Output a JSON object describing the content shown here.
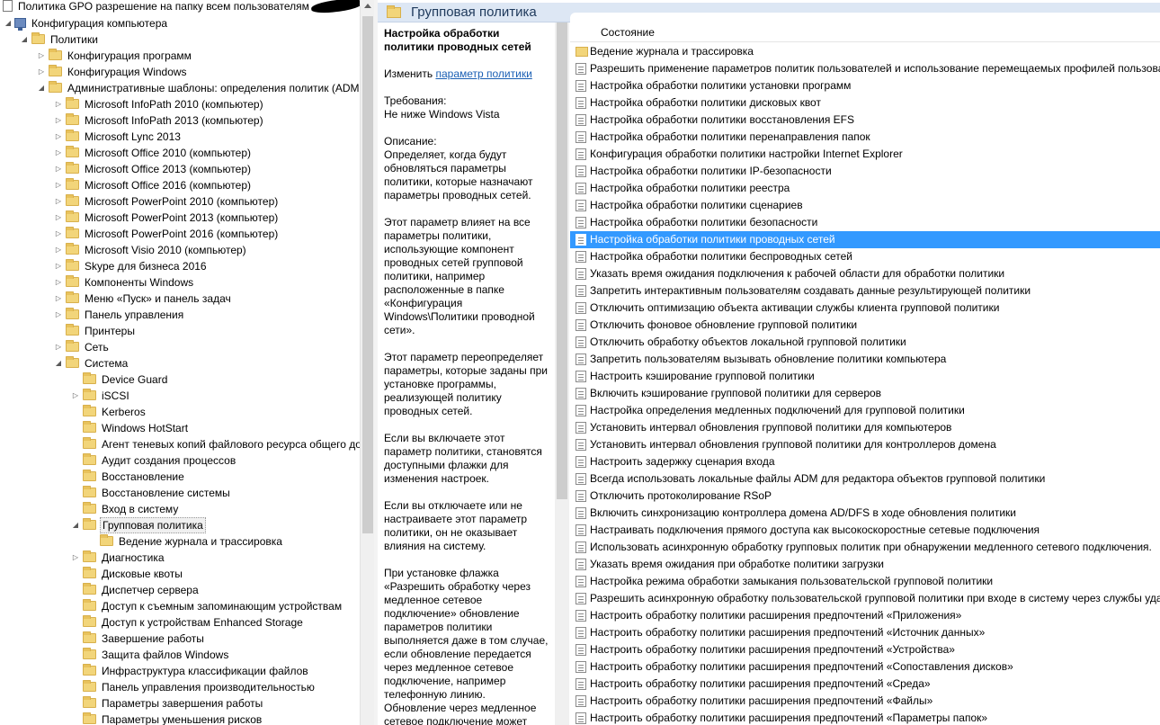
{
  "tree": {
    "root_title": "Политика GPO разрешение на папку всем пользователям",
    "items": [
      {
        "label": "Конфигурация компьютера",
        "level": 1,
        "expander": "open",
        "icon": "computer"
      },
      {
        "label": "Политики",
        "level": 2,
        "expander": "open",
        "icon": "folder"
      },
      {
        "label": "Конфигурация программ",
        "level": 3,
        "expander": "closed",
        "icon": "folder"
      },
      {
        "label": "Конфигурация Windows",
        "level": 3,
        "expander": "closed",
        "icon": "folder"
      },
      {
        "label": "Административные шаблоны: определения политик (ADMX",
        "level": 3,
        "expander": "open",
        "icon": "folder"
      },
      {
        "label": "Microsoft InfoPath 2010 (компьютер)",
        "level": 4,
        "expander": "closed",
        "icon": "folder"
      },
      {
        "label": "Microsoft InfoPath 2013 (компьютер)",
        "level": 4,
        "expander": "closed",
        "icon": "folder"
      },
      {
        "label": "Microsoft Lync 2013",
        "level": 4,
        "expander": "closed",
        "icon": "folder"
      },
      {
        "label": "Microsoft Office 2010 (компьютер)",
        "level": 4,
        "expander": "closed",
        "icon": "folder"
      },
      {
        "label": "Microsoft Office 2013 (компьютер)",
        "level": 4,
        "expander": "closed",
        "icon": "folder"
      },
      {
        "label": "Microsoft Office 2016 (компьютер)",
        "level": 4,
        "expander": "closed",
        "icon": "folder"
      },
      {
        "label": "Microsoft PowerPoint 2010 (компьютер)",
        "level": 4,
        "expander": "closed",
        "icon": "folder"
      },
      {
        "label": "Microsoft PowerPoint 2013 (компьютер)",
        "level": 4,
        "expander": "closed",
        "icon": "folder"
      },
      {
        "label": "Microsoft PowerPoint 2016 (компьютер)",
        "level": 4,
        "expander": "closed",
        "icon": "folder"
      },
      {
        "label": "Microsoft Visio 2010 (компьютер)",
        "level": 4,
        "expander": "closed",
        "icon": "folder"
      },
      {
        "label": "Skype для бизнеса 2016",
        "level": 4,
        "expander": "closed",
        "icon": "folder"
      },
      {
        "label": "Компоненты Windows",
        "level": 4,
        "expander": "closed",
        "icon": "folder"
      },
      {
        "label": "Меню «Пуск» и панель задач",
        "level": 4,
        "expander": "closed",
        "icon": "folder"
      },
      {
        "label": "Панель управления",
        "level": 4,
        "expander": "closed",
        "icon": "folder"
      },
      {
        "label": "Принтеры",
        "level": 4,
        "expander": "none",
        "icon": "folder"
      },
      {
        "label": "Сеть",
        "level": 4,
        "expander": "closed",
        "icon": "folder"
      },
      {
        "label": "Система",
        "level": 4,
        "expander": "open",
        "icon": "folder"
      },
      {
        "label": "Device Guard",
        "level": 5,
        "expander": "none",
        "icon": "folder"
      },
      {
        "label": "iSCSI",
        "level": 5,
        "expander": "closed",
        "icon": "folder"
      },
      {
        "label": "Kerberos",
        "level": 5,
        "expander": "none",
        "icon": "folder"
      },
      {
        "label": "Windows HotStart",
        "level": 5,
        "expander": "none",
        "icon": "folder"
      },
      {
        "label": "Агент теневых копий файлового ресурса общего до",
        "level": 5,
        "expander": "none",
        "icon": "folder"
      },
      {
        "label": "Аудит создания процессов",
        "level": 5,
        "expander": "none",
        "icon": "folder"
      },
      {
        "label": "Восстановление",
        "level": 5,
        "expander": "none",
        "icon": "folder"
      },
      {
        "label": "Восстановление системы",
        "level": 5,
        "expander": "none",
        "icon": "folder"
      },
      {
        "label": "Вход в систему",
        "level": 5,
        "expander": "none",
        "icon": "folder"
      },
      {
        "label": "Групповая политика",
        "level": 5,
        "expander": "open",
        "icon": "folder",
        "selected": true
      },
      {
        "label": "Ведение журнала и трассировка",
        "level": 6,
        "expander": "none",
        "icon": "folder"
      },
      {
        "label": "Диагностика",
        "level": 5,
        "expander": "closed",
        "icon": "folder"
      },
      {
        "label": "Дисковые квоты",
        "level": 5,
        "expander": "none",
        "icon": "folder"
      },
      {
        "label": "Диспетчер сервера",
        "level": 5,
        "expander": "none",
        "icon": "folder"
      },
      {
        "label": "Доступ к съемным запоминающим устройствам",
        "level": 5,
        "expander": "none",
        "icon": "folder"
      },
      {
        "label": "Доступ к устройствам Enhanced Storage",
        "level": 5,
        "expander": "none",
        "icon": "folder"
      },
      {
        "label": "Завершение работы",
        "level": 5,
        "expander": "none",
        "icon": "folder"
      },
      {
        "label": "Защита файлов Windows",
        "level": 5,
        "expander": "none",
        "icon": "folder"
      },
      {
        "label": "Инфраструктура классификации файлов",
        "level": 5,
        "expander": "none",
        "icon": "folder"
      },
      {
        "label": "Панель управления производительностью",
        "level": 5,
        "expander": "none",
        "icon": "folder"
      },
      {
        "label": "Параметры завершения работы",
        "level": 5,
        "expander": "none",
        "icon": "folder"
      },
      {
        "label": "Параметры уменьшения рисков",
        "level": 5,
        "expander": "none",
        "icon": "folder"
      }
    ]
  },
  "header": {
    "title": "Групповая политика"
  },
  "description": {
    "title": "Настройка обработки политики проводных сетей",
    "edit_prefix": "Изменить ",
    "edit_link": "параметр политики",
    "requirements_label": "Требования:",
    "requirements_value": "Не ниже Windows Vista",
    "description_label": "Описание:",
    "paragraphs": [
      "Определяет, когда будут обновляться параметры политики, которые назначают параметры проводных сетей.",
      "Этот параметр влияет на все параметры политики, использующие компонент проводных сетей групповой политики, например расположенные в папке «Конфигурация Windows\\Политики проводной сети».",
      "Этот параметр переопределяет параметры, которые заданы при установке программы, реализующей политику проводных сетей.",
      "Если вы включаете этот параметр политики, становятся доступными флажки для изменения настроек.",
      "Если вы отключаете или не настраиваете этот параметр политики, он не оказывает влияния на систему.",
      "При установке флажка «Разрешить обработку через медленное сетевое подключение» обновление параметров политики выполняется даже в том случае, если обновление передается через медленное сетевое подключение, например телефонную линию. Обновление через медленное сетевое подключение может"
    ]
  },
  "list": {
    "column_header": "Состояние",
    "items": [
      {
        "label": "Ведение журнала и трассировка",
        "type": "folder"
      },
      {
        "label": "Разрешить применение параметров политик пользователей и использование перемещаемых профилей пользоват",
        "type": "setting"
      },
      {
        "label": "Настройка обработки политики установки программ",
        "type": "setting"
      },
      {
        "label": "Настройка обработки политики дисковых квот",
        "type": "setting"
      },
      {
        "label": "Настройка обработки политики восстановления EFS",
        "type": "setting"
      },
      {
        "label": "Настройка обработки политики перенаправления папок",
        "type": "setting"
      },
      {
        "label": "Конфигурация обработки политики настройки Internet Explorer",
        "type": "setting"
      },
      {
        "label": "Настройка обработки политики IP-безопасности",
        "type": "setting"
      },
      {
        "label": "Настройка обработки политики реестра",
        "type": "setting"
      },
      {
        "label": "Настройка обработки политики сценариев",
        "type": "setting"
      },
      {
        "label": "Настройка обработки политики безопасности",
        "type": "setting"
      },
      {
        "label": "Настройка обработки политики проводных сетей",
        "type": "setting",
        "selected": true
      },
      {
        "label": "Настройка обработки политики беспроводных сетей",
        "type": "setting"
      },
      {
        "label": "Указать время ожидания подключения к рабочей области для обработки политики",
        "type": "setting"
      },
      {
        "label": "Запретить интерактивным пользователям создавать данные результирующей политики",
        "type": "setting"
      },
      {
        "label": "Отключить оптимизацию объекта активации службы клиента групповой политики",
        "type": "setting"
      },
      {
        "label": "Отключить фоновое обновление групповой политики",
        "type": "setting"
      },
      {
        "label": "Отключить обработку объектов локальной групповой политики",
        "type": "setting"
      },
      {
        "label": "Запретить пользователям вызывать обновление политики компьютера",
        "type": "setting"
      },
      {
        "label": "Настроить кэширование групповой политики",
        "type": "setting"
      },
      {
        "label": "Включить кэширование групповой политики для серверов",
        "type": "setting"
      },
      {
        "label": "Настройка определения медленных подключений для групповой политики",
        "type": "setting"
      },
      {
        "label": "Установить интервал обновления групповой политики для компьютеров",
        "type": "setting"
      },
      {
        "label": "Установить интервал обновления групповой политики для контроллеров домена",
        "type": "setting"
      },
      {
        "label": "Настроить задержку сценария входа",
        "type": "setting"
      },
      {
        "label": "Всегда использовать локальные файлы ADM для редактора объектов групповой политики",
        "type": "setting"
      },
      {
        "label": "Отключить протоколирование RSoP",
        "type": "setting"
      },
      {
        "label": "Включить синхронизацию контроллера домена AD/DFS в ходе обновления политики",
        "type": "setting"
      },
      {
        "label": "Настраивать подключения прямого доступа как высокоскоростные сетевые подключения",
        "type": "setting"
      },
      {
        "label": "Использовать асинхронную обработку групповых политик при обнаружении медленного сетевого подключения.",
        "type": "setting"
      },
      {
        "label": "Указать время ожидания при обработке политики загрузки",
        "type": "setting"
      },
      {
        "label": "Настройка режима обработки замыкания пользовательской групповой политики",
        "type": "setting"
      },
      {
        "label": "Разрешить асинхронную обработку пользовательской групповой политики при входе в систему через службы уда",
        "type": "setting"
      },
      {
        "label": "Настроить обработку политики расширения предпочтений «Приложения»",
        "type": "setting"
      },
      {
        "label": "Настроить обработку политики расширения предпочтений «Источник данных»",
        "type": "setting"
      },
      {
        "label": "Настроить обработку политики расширения предпочтений «Устройства»",
        "type": "setting"
      },
      {
        "label": "Настроить обработку политики расширения предпочтений «Сопоставления дисков»",
        "type": "setting"
      },
      {
        "label": "Настроить обработку политики расширения предпочтений «Среда»",
        "type": "setting"
      },
      {
        "label": "Настроить обработку политики расширения предпочтений «Файлы»",
        "type": "setting"
      },
      {
        "label": "Настроить обработку политики расширения предпочтений «Параметры папок»",
        "type": "setting"
      }
    ]
  },
  "colors": {
    "selection": "#3399ff",
    "header_bg": "#dde7f4",
    "folder": "#f2d57a",
    "link": "#1a5fb4"
  }
}
